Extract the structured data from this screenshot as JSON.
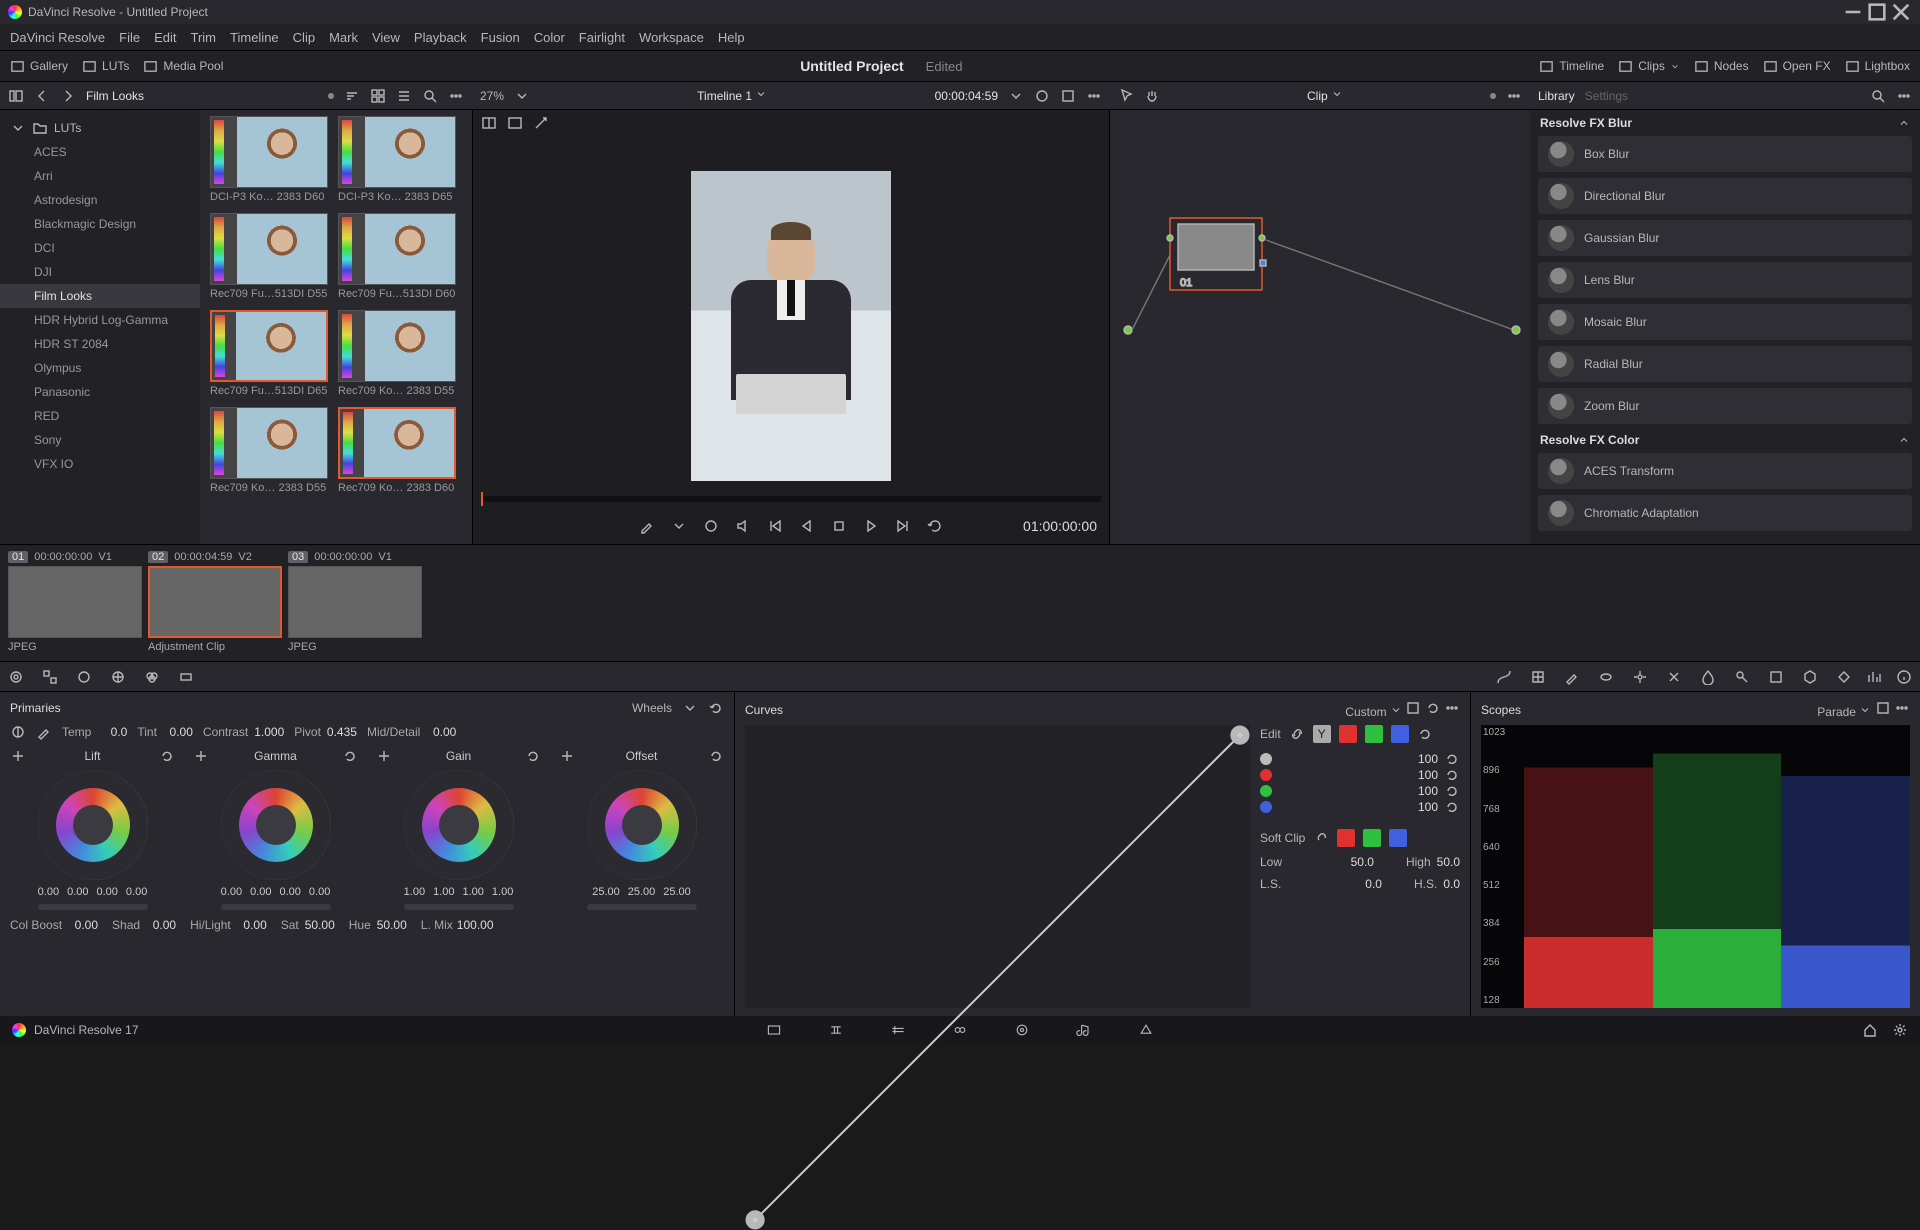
{
  "titlebar": {
    "title": "DaVinci Resolve - Untitled Project"
  },
  "menubar": [
    "DaVinci Resolve",
    "File",
    "Edit",
    "Trim",
    "Timeline",
    "Clip",
    "Mark",
    "View",
    "Playback",
    "Fusion",
    "Color",
    "Fairlight",
    "Workspace",
    "Help"
  ],
  "shelf_left": [
    {
      "label": "Gallery",
      "icon": "gallery-icon"
    },
    {
      "label": "LUTs",
      "icon": "luts-icon"
    },
    {
      "label": "Media Pool",
      "icon": "mediapool-icon"
    }
  ],
  "project": {
    "title": "Untitled Project",
    "status": "Edited"
  },
  "shelf_right": [
    {
      "label": "Timeline",
      "icon": "timeline-icon"
    },
    {
      "label": "Clips",
      "icon": "clips-icon"
    },
    {
      "label": "Nodes",
      "icon": "nodes-icon"
    },
    {
      "label": "Open FX",
      "icon": "openfx-icon"
    },
    {
      "label": "Lightbox",
      "icon": "lightbox-icon"
    }
  ],
  "strip": {
    "lut_title": "Film Looks",
    "zoom": "27%",
    "timeline": "Timeline 1",
    "timecode": "00:00:04:59",
    "clip_title": "Clip",
    "fx_tab_library": "Library",
    "fx_tab_settings": "Settings"
  },
  "lut_tree": {
    "root": "LUTs",
    "cats": [
      "ACES",
      "Arri",
      "Astrodesign",
      "Blackmagic Design",
      "DCI",
      "DJI",
      "Film Looks",
      "HDR Hybrid Log-Gamma",
      "HDR ST 2084",
      "Olympus",
      "Panasonic",
      "RED",
      "Sony",
      "VFX IO"
    ],
    "selected": "Film Looks"
  },
  "lut_thumbs": [
    {
      "label": "DCI-P3 Ko… 2383 D60"
    },
    {
      "label": "DCI-P3 Ko… 2383 D65"
    },
    {
      "label": "Rec709 Fu…513DI D55"
    },
    {
      "label": "Rec709 Fu…513DI D60"
    },
    {
      "label": "Rec709 Fu…513DI D65",
      "sel": true
    },
    {
      "label": "Rec709 Ko… 2383 D55"
    },
    {
      "label": "Rec709 Ko… 2383 D55"
    },
    {
      "label": "Rec709 Ko… 2383 D60",
      "sel": true
    }
  ],
  "viewer": {
    "tc": "01:00:00:00"
  },
  "nodes": {
    "node_label": "01"
  },
  "fx": {
    "sections": [
      {
        "title": "Resolve FX Blur",
        "items": [
          "Box Blur",
          "Directional Blur",
          "Gaussian Blur",
          "Lens Blur",
          "Mosaic Blur",
          "Radial Blur",
          "Zoom Blur"
        ]
      },
      {
        "title": "Resolve FX Color",
        "items": [
          "ACES Transform",
          "Chromatic Adaptation"
        ]
      }
    ]
  },
  "clips": [
    {
      "idx": "01",
      "tc": "00:00:00:00",
      "trk": "V1",
      "name": "JPEG"
    },
    {
      "idx": "02",
      "tc": "00:00:04:59",
      "trk": "V2",
      "name": "Adjustment Clip",
      "sel": true
    },
    {
      "idx": "03",
      "tc": "00:00:00:00",
      "trk": "V1",
      "name": "JPEG"
    }
  ],
  "primaries": {
    "title": "Primaries",
    "mode": "Wheels",
    "params": {
      "temp": {
        "label": "Temp",
        "value": "0.0"
      },
      "tint": {
        "label": "Tint",
        "value": "0.00"
      },
      "contrast": {
        "label": "Contrast",
        "value": "1.000"
      },
      "pivot": {
        "label": "Pivot",
        "value": "0.435"
      },
      "middetail": {
        "label": "Mid/Detail",
        "value": "0.00"
      }
    },
    "wheels": [
      {
        "title": "Lift",
        "nums": [
          "0.00",
          "0.00",
          "0.00",
          "0.00"
        ]
      },
      {
        "title": "Gamma",
        "nums": [
          "0.00",
          "0.00",
          "0.00",
          "0.00"
        ]
      },
      {
        "title": "Gain",
        "nums": [
          "1.00",
          "1.00",
          "1.00",
          "1.00"
        ]
      },
      {
        "title": "Offset",
        "nums": [
          "25.00",
          "25.00",
          "25.00"
        ]
      }
    ],
    "footer": [
      {
        "label": "Col Boost",
        "value": "0.00"
      },
      {
        "label": "Shad",
        "value": "0.00"
      },
      {
        "label": "Hi/Light",
        "value": "0.00"
      },
      {
        "label": "Sat",
        "value": "50.00"
      },
      {
        "label": "Hue",
        "value": "50.00"
      },
      {
        "label": "L. Mix",
        "value": "100.00"
      }
    ]
  },
  "curves": {
    "title": "Curves",
    "mode": "Custom",
    "edit_label": "Edit",
    "channels": [
      {
        "color": "#bbb",
        "value": "100"
      },
      {
        "color": "#e03030",
        "value": "100"
      },
      {
        "color": "#30c040",
        "value": "100"
      },
      {
        "color": "#4060e0",
        "value": "100"
      }
    ],
    "softclip": "Soft Clip",
    "low": {
      "label": "Low",
      "value": "50.0"
    },
    "high": {
      "label": "High",
      "value": "50.0"
    },
    "ls": {
      "label": "L.S.",
      "value": "0.0"
    },
    "hs": {
      "label": "H.S.",
      "value": "0.0"
    }
  },
  "scopes": {
    "title": "Scopes",
    "mode": "Parade",
    "ticks": [
      "1023",
      "896",
      "768",
      "640",
      "512",
      "384",
      "256",
      "128"
    ]
  },
  "footer_app": "DaVinci Resolve 17"
}
